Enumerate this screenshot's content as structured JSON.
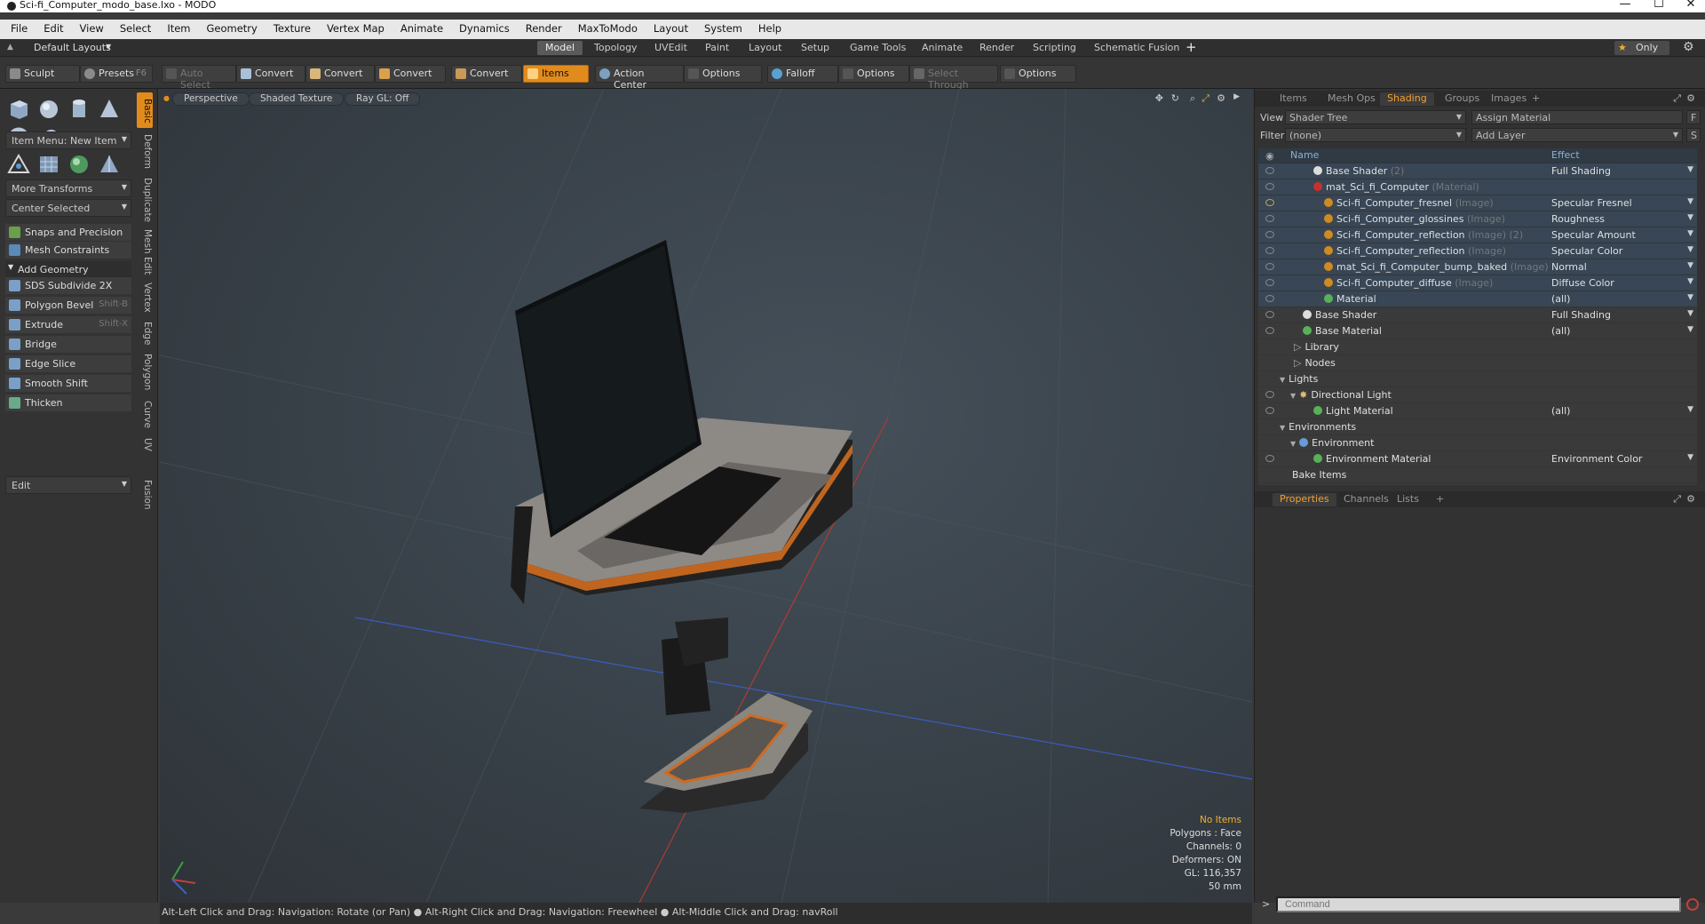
{
  "window": {
    "title": "Sci-fi_Computer_modo_base.lxo - MODO",
    "minimize": "—",
    "maximize": "☐",
    "close": "✕"
  },
  "menu": [
    "File",
    "Edit",
    "View",
    "Select",
    "Item",
    "Geometry",
    "Texture",
    "Vertex Map",
    "Animate",
    "Dynamics",
    "Render",
    "MaxToModo",
    "Layout",
    "System",
    "Help"
  ],
  "layoutbar": {
    "layouts_label": "Default Layouts",
    "tabs": [
      "Model",
      "Topology",
      "UVEdit",
      "Paint",
      "Layout",
      "Setup",
      "Game Tools",
      "Animate",
      "Render",
      "Scripting",
      "Schematic Fusion"
    ],
    "add": "+",
    "only": "Only",
    "only_star": "★"
  },
  "toolbar": {
    "sculpt": "Sculpt",
    "presets": "Presets",
    "presets_key": "F6",
    "auto_select": "Auto Select",
    "convert1": "Convert",
    "convert2": "Convert",
    "convert3": "Convert",
    "convert4": "Convert",
    "items": "Items",
    "action_center": "Action Center",
    "options1": "Options",
    "falloff": "Falloff",
    "options2": "Options",
    "select_through": "Select Through",
    "options3": "Options"
  },
  "leftpanel": {
    "item_menu": "Item Menu: New Item",
    "more_transforms": "More Transforms",
    "center_selected": "Center Selected",
    "snaps": "Snaps and Precision",
    "mesh_constraints": "Mesh Constraints",
    "add_geometry": "Add Geometry",
    "tools": [
      {
        "label": "SDS Subdivide 2X",
        "key": ""
      },
      {
        "label": "Polygon Bevel",
        "key": "Shift-B"
      },
      {
        "label": "Extrude",
        "key": "Shift-X"
      },
      {
        "label": "Bridge",
        "key": ""
      },
      {
        "label": "Edge Slice",
        "key": ""
      },
      {
        "label": "Smooth Shift",
        "key": ""
      },
      {
        "label": "Thicken",
        "key": ""
      }
    ],
    "edit": "Edit",
    "vtabs": [
      "Basic",
      "Deform",
      "Duplicate",
      "Mesh Edit",
      "Vertex",
      "Edge",
      "Polygon",
      "Curve",
      "UV",
      "Fusion"
    ]
  },
  "viewport": {
    "perspective": "Perspective",
    "shaded": "Shaded Texture",
    "raygl": "Ray GL: Off",
    "info": {
      "no_items": "No Items",
      "polygons": "Polygons : Face",
      "channels": "Channels: 0",
      "deformers": "Deformers: ON",
      "gl": "GL: 116,357",
      "focal": "50 mm"
    }
  },
  "status": "Alt-Left Click and Drag: Navigation: Rotate (or Pan) ● Alt-Right Click and Drag: Navigation: Freewheel ● Alt-Middle Click and Drag: navRoll",
  "rightpanel": {
    "tabs": [
      "Items",
      "Mesh Ops",
      "Shading",
      "Groups",
      "Images",
      "+"
    ],
    "view_label": "View",
    "view_value": "Shader Tree",
    "assign_material": "Assign Material",
    "assign_key": "F",
    "filter_label": "Filter",
    "filter_value": "(none)",
    "add_layer": "Add Layer",
    "add_layer_key": "S",
    "col_name": "Name",
    "col_effect": "Effect",
    "rows": [
      {
        "name": "Base Shader",
        "suffix": "(2)",
        "effect": "Full Shading"
      },
      {
        "name": "mat_Sci_fi_Computer",
        "suffix": "(Material)",
        "effect": ""
      },
      {
        "name": "Sci-fi_Computer_fresnel",
        "suffix": "(Image)",
        "effect": "Specular Fresnel"
      },
      {
        "name": "Sci-fi_Computer_glossines",
        "suffix": "(Image)",
        "effect": "Roughness"
      },
      {
        "name": "Sci-fi_Computer_reflection",
        "suffix": "(Image) (2)",
        "effect": "Specular Amount"
      },
      {
        "name": "Sci-fi_Computer_reflection",
        "suffix": "(Image)",
        "effect": "Specular Color"
      },
      {
        "name": "mat_Sci_fi_Computer_bump_baked",
        "suffix": "(Image)",
        "effect": "Normal"
      },
      {
        "name": "Sci-fi_Computer_diffuse",
        "suffix": "(Image)",
        "effect": "Diffuse Color"
      },
      {
        "name": "Material",
        "suffix": "",
        "effect": "(all)"
      },
      {
        "name": "Base Shader",
        "suffix": "",
        "effect": "Full Shading"
      },
      {
        "name": "Base Material",
        "suffix": "",
        "effect": "(all)"
      },
      {
        "name": "Library",
        "suffix": "",
        "effect": ""
      },
      {
        "name": "Nodes",
        "suffix": "",
        "effect": ""
      },
      {
        "name": "Lights",
        "suffix": "",
        "effect": ""
      },
      {
        "name": "Directional Light",
        "suffix": "",
        "effect": ""
      },
      {
        "name": "Light Material",
        "suffix": "",
        "effect": "(all)"
      },
      {
        "name": "Environments",
        "suffix": "",
        "effect": ""
      },
      {
        "name": "Environment",
        "suffix": "",
        "effect": ""
      },
      {
        "name": "Environment Material",
        "suffix": "",
        "effect": "Environment Color"
      },
      {
        "name": "Bake Items",
        "suffix": "",
        "effect": ""
      }
    ],
    "props_tabs": [
      "Properties",
      "Channels",
      "Lists",
      "+"
    ],
    "command_placeholder": "Command",
    "command_prompt": ">"
  }
}
